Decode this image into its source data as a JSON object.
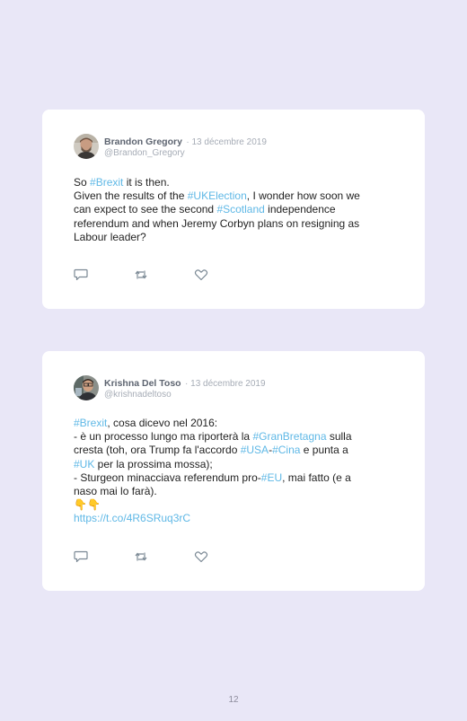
{
  "page_number": "12",
  "tweets": [
    {
      "name": "Brandon Gregory",
      "date": "· 13 décembre 2019",
      "handle": "@Brandon_Gregory",
      "body": {
        "l1_pre": "So ",
        "l1_tag": "#Brexit",
        "l1_post": " it is then.",
        "l2_pre": "Given the results of the ",
        "l2_tag": "#UKElection",
        "l2_post": ", I wonder how soon we",
        "l3_pre": "can expect to see the second ",
        "l3_tag": "#Scotland",
        "l3_post": " independence",
        "l4": "referendum and when Jeremy Corbyn plans on resigning as",
        "l5": "Labour leader?"
      }
    },
    {
      "name": "Krishna Del Toso",
      "date": "· 13 décembre 2019",
      "handle": "@krishnadeltoso",
      "body": {
        "l1_tag": "#Brexit",
        "l1_post": ", cosa dicevo nel 2016:",
        "l2_pre": "- è un processo lungo ma riporterà la ",
        "l2_tag": "#GranBretagna",
        "l2_post": " sulla",
        "l3_pre": "cresta (toh, ora Trump fa l'accordo ",
        "l3_tag1": "#USA",
        "l3_mid": "-",
        "l3_tag2": "#Cina",
        "l3_post": " e punta a",
        "l4_tag": "#UK",
        "l4_post": " per la prossima mossa);",
        "l5_pre": "- Sturgeon minacciava referendum pro-",
        "l5_tag": "#EU",
        "l5_post": ", mai fatto (e a",
        "l6": "naso mai lo farà).",
        "emoji": "👇👇",
        "link": "https://t.co/4R6SRuq3rC"
      }
    }
  ],
  "icons": [
    "reply-icon",
    "retweet-icon",
    "like-icon"
  ],
  "colors": {
    "background": "#e9e7f7",
    "card": "#ffffff",
    "hashtag": "#5fb8e6",
    "icon": "#7a8894"
  }
}
